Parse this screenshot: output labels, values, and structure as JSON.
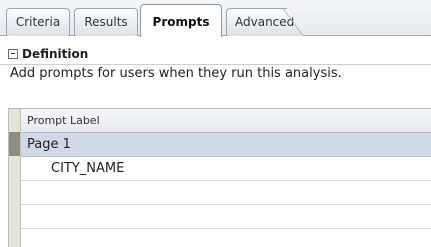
{
  "tabs": [
    {
      "label": "Criteria",
      "active": false
    },
    {
      "label": "Results",
      "active": false
    },
    {
      "label": "Prompts",
      "active": true
    },
    {
      "label": "Advanced",
      "active": false
    }
  ],
  "definition": {
    "title": "Definition",
    "description": "Add prompts for users when they run this analysis."
  },
  "grid": {
    "column_header": "Prompt Label",
    "page_label": "Page 1",
    "prompts": [
      "CITY_NAME"
    ]
  },
  "colors": {
    "page_row_bg": "#cfd8e6",
    "gutter_bg": "#e4e4d5",
    "gutter_selected": "#8d8d83"
  }
}
